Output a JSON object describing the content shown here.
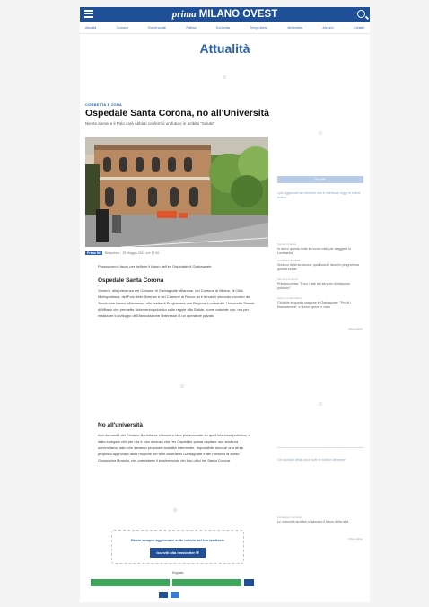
{
  "header": {
    "brand_prefix": "prima",
    "brand_name": "MILANO OVEST",
    "menu_icon": "hamburger-icon",
    "search_icon": "search-icon",
    "color": "#1f4f96"
  },
  "nav": {
    "items": [
      "Attualità",
      "Cronaca",
      "Eventi sociali",
      "Politica",
      "Economia",
      "Tempo libero",
      "Multimedia",
      "Annunci",
      "Contatti"
    ]
  },
  "section": {
    "title": "Attualità"
  },
  "article": {
    "kicker": "CORBETTA E ZONA",
    "headline": "Ospedale Santa Corona, no all'Università",
    "subtitle": "Niente atenei e il Polo sarà Abbiati confermò un futuro in ambito \"Salute\"",
    "byline_tag": "Prima MI",
    "byline_text": "Redazione · 25 Maggio 2021 ore 17:00",
    "intro": "Proseguono i lavori per definire il futuro dell'ex Ospedale di Garbagnate",
    "section1_title": "Ospedale Santa Corona",
    "section1_text": "Venerdì, alla presenza del Comune di Garbagnate Milanese, del Comune di Milano, di Città Metropolitana, del Polo delle Scienze e del Comune di Rocco, si è tenuto il secondo incontro del Tavolo che hanno all'annesso alla scelta di Programma con Regione Lombardia, Università Statale di Milano che permette l'intervento pubblico sulle regole alla Salute, come naturale con, ma per realizzare lo sviluppo dell'Associazione l'interesse di un operatore privato.",
    "section2_title": "No all'università",
    "section2_text": "Alla domanda del Sindaco Barletta se vi fossero idee più avanzate su quell'interesse pubblico, è stato spiegato che per ora è solo escluso che l'ex Ospedale possa ospitare una struttura universitaria, dato che saranno proposte modalità intermedie. Impossibile dunque una terza proposta approvata dalla Regione dei temi illustrati in Garbagnate e del Pontano di Arese Giuseppina Rosella, che potrebbero il trasferimento dei loro uffici nel Santa Corona."
  },
  "newsletter": {
    "text": "Resta sempre aggiornato sulle notizie del tuo territorio",
    "button_label": "Iscriviti alla newsletter"
  },
  "share": {
    "label": "Segnala",
    "facebook_color": "#3ea65b",
    "email_icon": "mail-icon"
  },
  "sidebar": {
    "bar_label": "Più letti",
    "items": [
      {
        "cat": "",
        "text": "I più aggiornati sul territorio che ti interessa: leggi le ultime notizie"
      },
      {
        "cat": "Nuove iniziative",
        "text": "In arrivo questa notte le nuove rotte per viaggiare in Lombardia"
      },
      {
        "cat": "Cronaca e attualità",
        "text": "Sindaco della sicurezza: quali sono i lavori in programma questa estate"
      },
      {
        "cat": "Servizi e territorio",
        "text": "Primi successi: \"Ecco i dati del servizio di trasporto pubblico\""
      },
      {
        "cat": "Sport e tempo libero",
        "text": "Ciclabile in questa stagione in Garbagnate: \"Pronti i finanziamenti\" e nuove opere in vista"
      },
      {
        "cat": "",
        "text": "Gli ospedali della zona: tutte le notizie del mese"
      },
      {
        "cat": "Comunità e territorio",
        "text": "Le comunità sportive si giocano il futuro della città"
      }
    ],
    "more_label": "Altre notizie"
  }
}
